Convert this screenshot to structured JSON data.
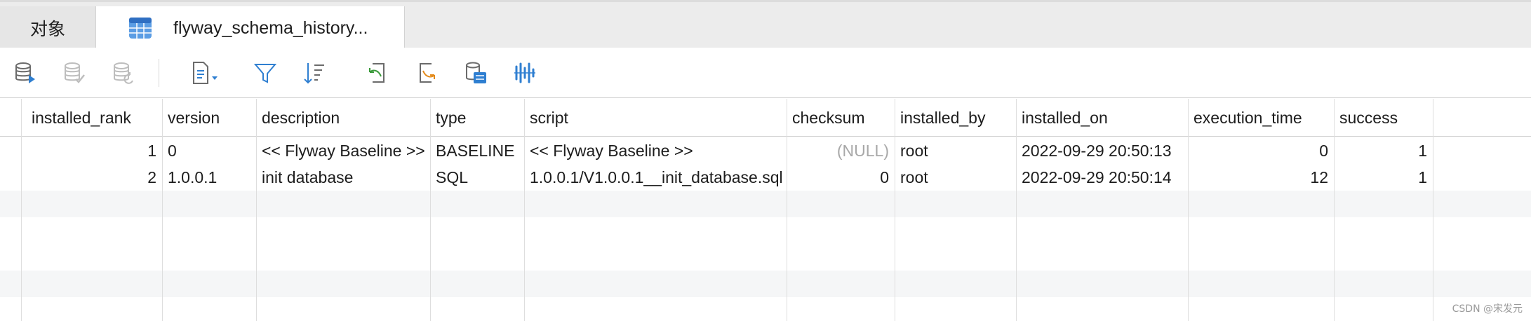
{
  "tabs": [
    {
      "label": "对象"
    },
    {
      "label": "flyway_schema_history..."
    }
  ],
  "toolbar": {
    "icons": [
      "begin-transaction-icon",
      "commit-icon",
      "rollback-icon",
      "text-view-icon",
      "filter-icon",
      "sort-icon",
      "import-icon",
      "export-icon",
      "data-generator-icon",
      "chart-icon"
    ]
  },
  "table": {
    "columns": [
      "installed_rank",
      "version",
      "description",
      "type",
      "script",
      "checksum",
      "installed_by",
      "installed_on",
      "execution_time",
      "success"
    ],
    "rows": [
      [
        "1",
        "0",
        "<< Flyway Baseline >>",
        "BASELINE",
        "<< Flyway Baseline >>",
        "(NULL)",
        "root",
        "2022-09-29 20:50:13",
        "0",
        "1"
      ],
      [
        "2",
        "1.0.0.1",
        "init database",
        "SQL",
        "1.0.0.1/V1.0.0.1__init_database.sql",
        "0",
        "root",
        "2022-09-29 20:50:14",
        "12",
        "1"
      ]
    ]
  },
  "watermark": "CSDN @宋发元",
  "colors": {
    "accent": "#2f7fd1",
    "null_text": "#a8a8a8",
    "alt_row": "#f5f6f7"
  }
}
